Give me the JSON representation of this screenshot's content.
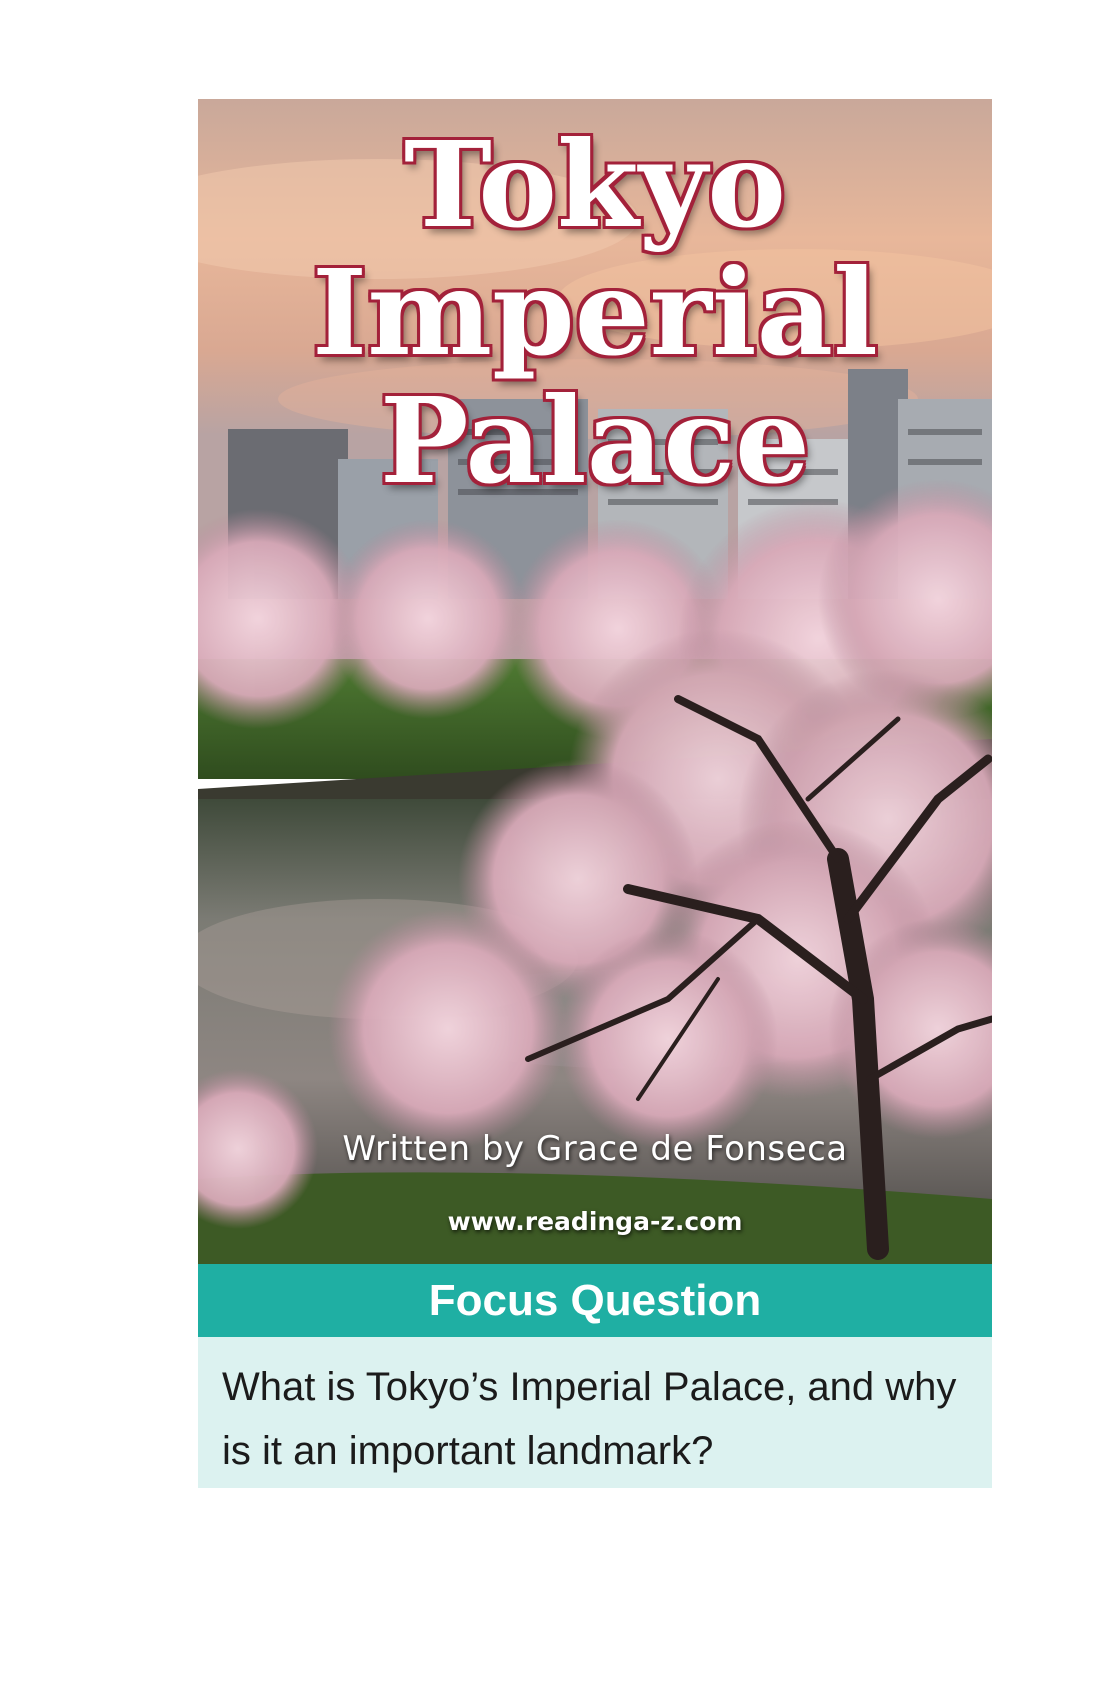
{
  "cover": {
    "title_lines": [
      "Tokyo",
      "Imperial",
      "Palace"
    ],
    "author": "Written by Grace de Fonseca",
    "url": "www.readinga-z.com",
    "photo": "cherry-blossom-moat-photo"
  },
  "focus": {
    "heading": "Focus Question",
    "question": "What is Tokyo’s Imperial Palace, and why is it an important landmark?"
  },
  "colors": {
    "focus_bar": "#1fafa3",
    "focus_body": "#dcf2f0",
    "title_outline": "#a3213a"
  }
}
